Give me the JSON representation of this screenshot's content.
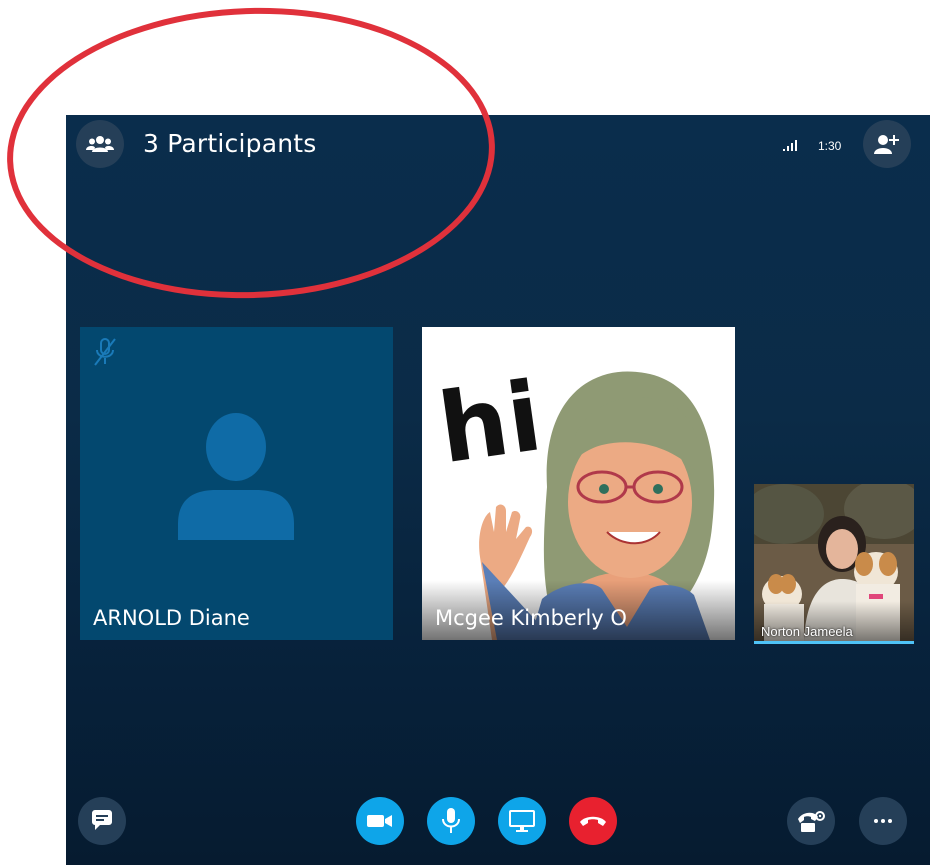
{
  "header": {
    "participants_label": "3 Participants",
    "call_timer": "1:30",
    "icons": {
      "participants": "people-group-icon",
      "signal": "signal-strength-icon",
      "add_person": "add-person-icon"
    }
  },
  "tiles": [
    {
      "name": "ARNOLD Diane",
      "kind": "avatar-placeholder",
      "muted": true,
      "icon": "person-placeholder-icon"
    },
    {
      "name": "Mcgee Kimberly O",
      "kind": "bitmoji-image",
      "image_text": "hi"
    },
    {
      "name": "Norton Jameela",
      "kind": "video-thumbnail",
      "active_speaker": true
    }
  ],
  "controls": {
    "left": {
      "icon": "chat-bubble-icon"
    },
    "center": [
      {
        "id": "video",
        "icon": "video-camera-icon",
        "color": "#0ea5e9"
      },
      {
        "id": "mic",
        "icon": "microphone-icon",
        "color": "#0ea5e9"
      },
      {
        "id": "share",
        "icon": "screen-share-icon",
        "color": "#0ea5e9"
      },
      {
        "id": "end",
        "icon": "hang-up-icon",
        "color": "#e8212f"
      }
    ],
    "right": [
      {
        "id": "dialpad",
        "icon": "phone-settings-icon"
      },
      {
        "id": "more",
        "icon": "more-options-icon"
      }
    ]
  },
  "colors": {
    "annotation": "#e0313b",
    "accent": "#0ea5e9",
    "end_call": "#e8212f",
    "active_speaker_underline": "#4fc3f7"
  }
}
